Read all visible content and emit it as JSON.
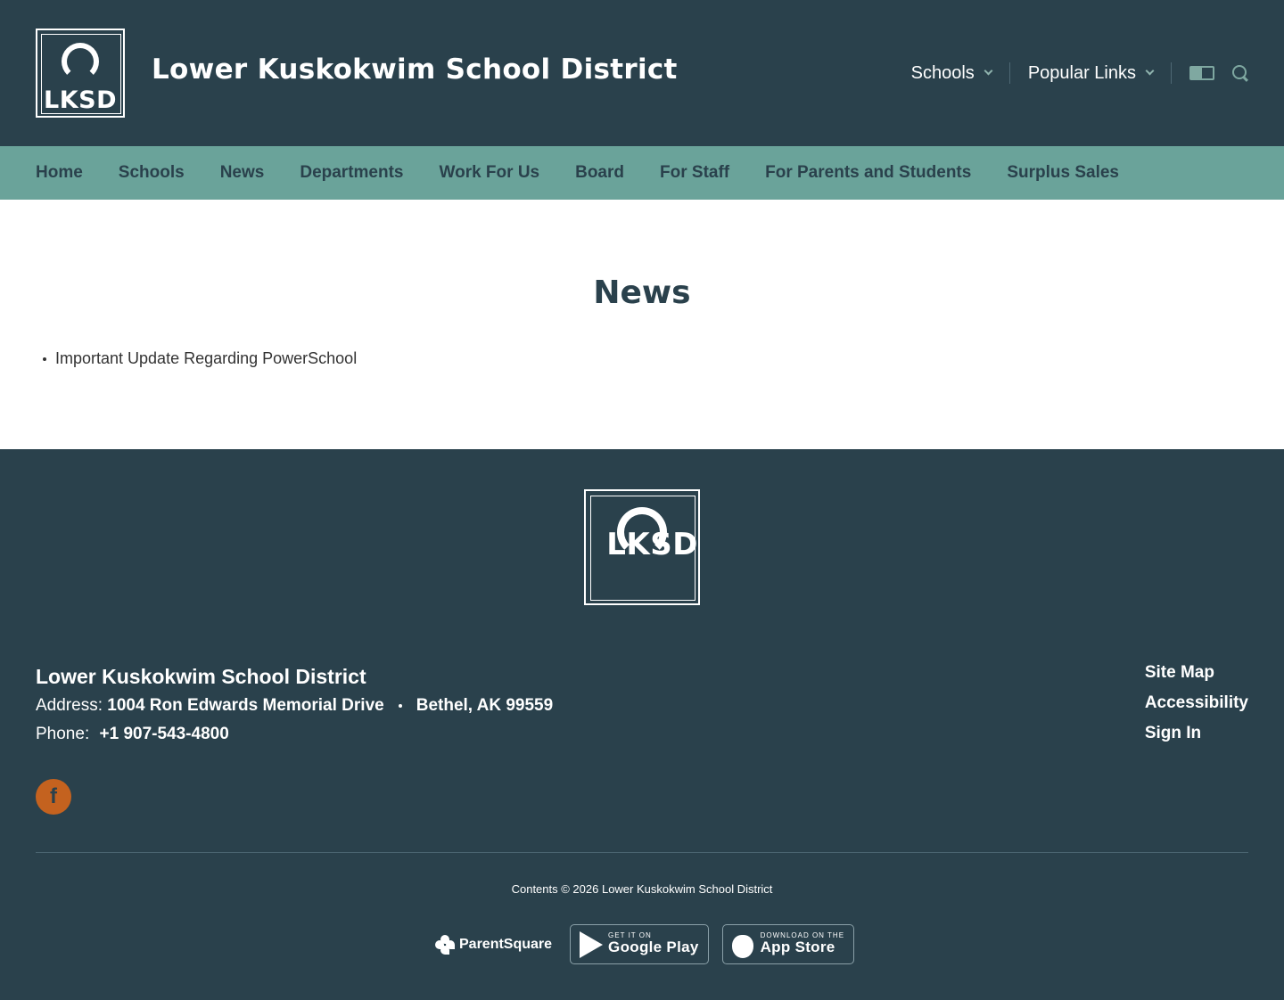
{
  "header": {
    "logo_text": "LKSD",
    "site_title": "Lower Kuskokwim School District",
    "util_nav": [
      {
        "label": "Schools"
      },
      {
        "label": "Popular Links"
      }
    ]
  },
  "main_nav": [
    "Home",
    "Schools",
    "News",
    "Departments",
    "Work For Us",
    "Board",
    "For Staff",
    "For Parents and Students",
    "Surplus Sales"
  ],
  "content": {
    "title": "News",
    "items": [
      "Important Update Regarding PowerSchool"
    ]
  },
  "footer": {
    "logo_text": "LKSD",
    "name": "Lower Kuskokwim School District",
    "address_label": "Address:",
    "address_street": "1004 Ron Edwards Memorial Drive",
    "address_city": "Bethel, AK 99559",
    "phone_label": "Phone:",
    "phone": "+1 907-543-4800",
    "links": [
      "Site Map",
      "Accessibility",
      "Sign In"
    ],
    "facebook_glyph": "f",
    "copyright": "Contents © 2026 Lower Kuskokwim School District",
    "parentsquare": "ParentSquare",
    "google_play": {
      "small": "GET IT ON",
      "big": "Google Play"
    },
    "app_store": {
      "small": "DOWNLOAD ON THE",
      "big": "App Store"
    }
  },
  "colors": {
    "header_bg": "#2a414c",
    "nav_bg": "#6aa39a",
    "facebook_accent": "#c4621f"
  }
}
